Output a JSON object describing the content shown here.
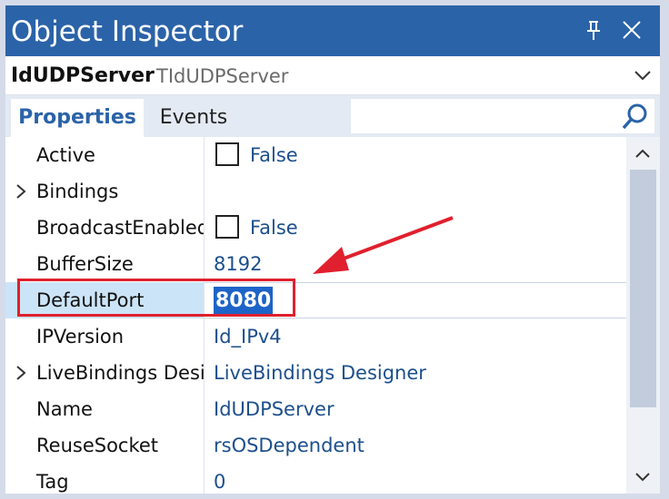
{
  "window": {
    "title": "Object Inspector"
  },
  "component": {
    "name": "IdUDPServer",
    "type": "TIdUDPServer"
  },
  "tabs": {
    "properties": "Properties",
    "events": "Events"
  },
  "search": {
    "placeholder": ""
  },
  "properties": [
    {
      "name": "Active",
      "value": "False",
      "has_checkbox": true,
      "expandable": false,
      "selected": false
    },
    {
      "name": "Bindings",
      "value": "",
      "has_checkbox": false,
      "expandable": true,
      "selected": false
    },
    {
      "name": "BroadcastEnabled",
      "value": "False",
      "has_checkbox": true,
      "expandable": false,
      "selected": false
    },
    {
      "name": "BufferSize",
      "value": "8192",
      "has_checkbox": false,
      "expandable": false,
      "selected": false
    },
    {
      "name": "DefaultPort",
      "value": "8080",
      "has_checkbox": false,
      "expandable": false,
      "selected": true
    },
    {
      "name": "IPVersion",
      "value": "Id_IPv4",
      "has_checkbox": false,
      "expandable": false,
      "selected": false
    },
    {
      "name": "LiveBindings Designer",
      "value": "LiveBindings Designer",
      "has_checkbox": false,
      "expandable": true,
      "selected": false
    },
    {
      "name": "Name",
      "value": "IdUDPServer",
      "has_checkbox": false,
      "expandable": false,
      "selected": false
    },
    {
      "name": "ReuseSocket",
      "value": "rsOSDependent",
      "has_checkbox": false,
      "expandable": false,
      "selected": false
    },
    {
      "name": "Tag",
      "value": "0",
      "has_checkbox": false,
      "expandable": false,
      "selected": false
    }
  ],
  "icons": {
    "pin": "pin-icon",
    "close": "close-icon",
    "dropdown": "chevron-down-icon",
    "search": "search-icon",
    "expand": "chevron-right-icon",
    "scroll_up": "chevron-up-icon",
    "scroll_down": "chevron-down-icon"
  },
  "colors": {
    "titlebar": "#2b63a8",
    "accent": "#2b63a8",
    "value_text": "#1d4f8c",
    "selected_name_bg": "#cce4f7",
    "edit_highlight": "#1d64c8",
    "annotation": "#e0202e"
  }
}
